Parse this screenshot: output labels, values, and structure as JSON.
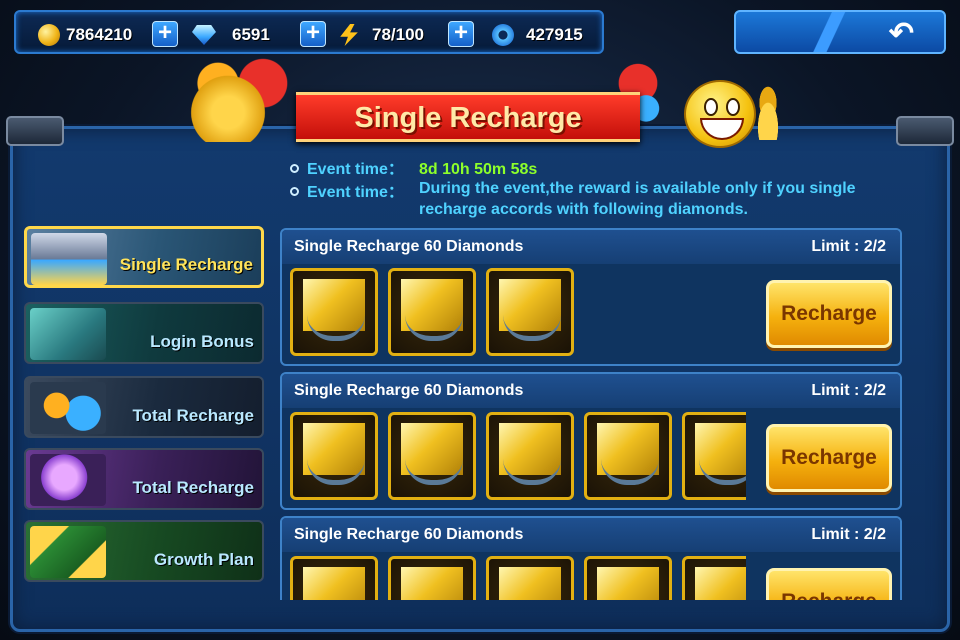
{
  "resources": {
    "gold": "7864210",
    "diamonds": "6591",
    "energy": "78/100",
    "gears": "427915"
  },
  "banner": {
    "title": "Single Recharge"
  },
  "event": {
    "time_label": "Event time：",
    "time_value": "8d 10h 50m 58s",
    "desc_label": "Event time：",
    "desc_value": "During the event,the reward is available only if you single recharge accords with following diamonds."
  },
  "sidebar": {
    "tabs": [
      {
        "label": "Single Recharge",
        "active": true
      },
      {
        "label": "Login Bonus",
        "active": false
      },
      {
        "label": "Total Recharge",
        "active": false
      },
      {
        "label": "Total Recharge",
        "active": false
      },
      {
        "label": "Growth Plan",
        "active": false
      }
    ]
  },
  "rewards": [
    {
      "title": "Single Recharge 60 Diamonds",
      "limit": "Limit : 2/2",
      "item_count": 3,
      "button": "Recharge"
    },
    {
      "title": "Single Recharge 60 Diamonds",
      "limit": "Limit : 2/2",
      "item_count": 5,
      "button": "Recharge"
    },
    {
      "title": "Single Recharge 60 Diamonds",
      "limit": "Limit : 2/2",
      "item_count": 5,
      "button": "Recharge"
    }
  ],
  "icons": {
    "gold": "coin-icon",
    "diamonds": "diamond-icon",
    "energy": "lightning-icon",
    "gears": "gear-icon",
    "back": "back-arrow-icon"
  },
  "colors": {
    "accent_blue": "#4fd2ff",
    "countdown_green": "#8dff2a",
    "active_tab_border": "#ffd84a",
    "button_gold": "#f5b10e"
  }
}
